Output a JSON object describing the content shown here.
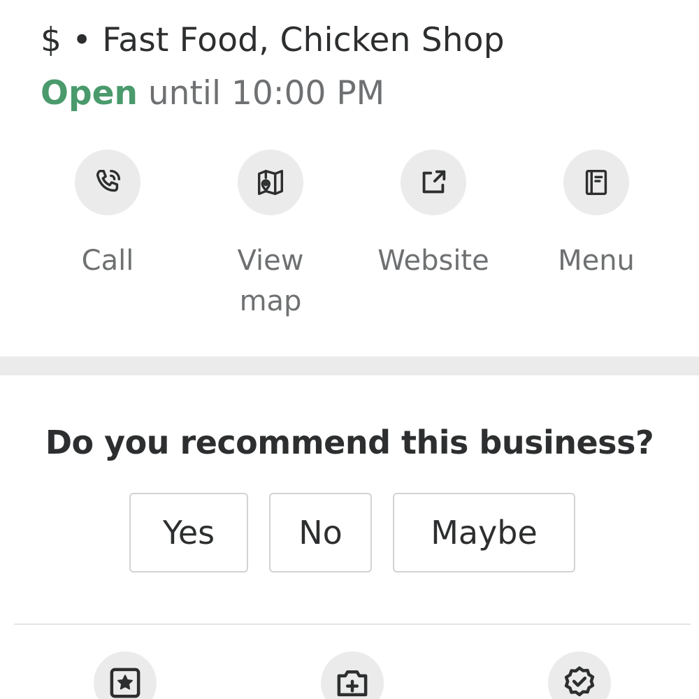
{
  "business": {
    "price_and_categories": "$ • Fast Food, Chicken Shop",
    "status": "Open",
    "hours": "until 10:00 PM"
  },
  "actions": [
    {
      "label": "Call",
      "icon": "phone-icon"
    },
    {
      "label": "View\nmap",
      "icon": "map-icon"
    },
    {
      "label": "Website",
      "icon": "external-link-icon"
    },
    {
      "label": "Menu",
      "icon": "menu-book-icon"
    }
  ],
  "recommend": {
    "question": "Do you recommend this business?",
    "options": [
      "Yes",
      "No",
      "Maybe"
    ]
  },
  "bottom_actions": [
    {
      "icon": "review-star-icon"
    },
    {
      "icon": "add-photo-icon"
    },
    {
      "icon": "check-in-badge-icon"
    }
  ],
  "colors": {
    "open_green": "#4a9a6c",
    "text_dark": "#2d2e2f",
    "text_gray": "#6e7072",
    "circle_bg": "#ebebeb"
  }
}
